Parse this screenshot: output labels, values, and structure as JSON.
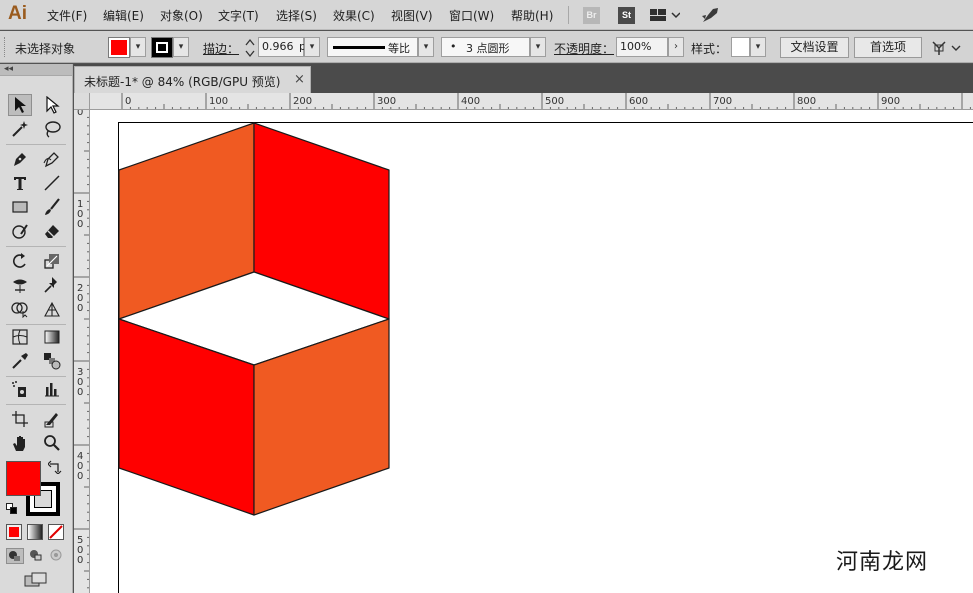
{
  "app": {
    "logo": "Ai"
  },
  "menu": {
    "items": [
      "文件(F)",
      "编辑(E)",
      "对象(O)",
      "文字(T)",
      "选择(S)",
      "效果(C)",
      "视图(V)",
      "窗口(W)",
      "帮助(H)"
    ],
    "bridge_label": "Br",
    "stock_label": "St"
  },
  "control": {
    "selection_status": "未选择对象",
    "stroke_label": "描边：",
    "stroke_weight": "0.966",
    "stroke_unit": "p",
    "profile_label": "等比",
    "brush_label": "3 点圆形",
    "opacity_label": "不透明度：",
    "opacity_value": "100%",
    "style_label": "样式：",
    "doc_setup_button": "文档设置",
    "preferences_button": "首选项",
    "fill_color": "#ff0000",
    "stroke_color": "#000000"
  },
  "tools": {
    "header": "◂◂",
    "fill_color": "#ff0000",
    "stroke_color": "#000000"
  },
  "document": {
    "tab_title": "未标题-1* @ 84% (RGB/GPU 预览)",
    "close_glyph": "×",
    "zoom": "84%",
    "color_mode": "RGB/GPU 预览"
  },
  "rulers": {
    "horizontal_labels": [
      "0",
      "100",
      "200",
      "300",
      "400",
      "500",
      "600",
      "700",
      "800",
      "900"
    ],
    "vertical_labels": [
      "0",
      "100",
      "200",
      "300",
      "400",
      "500"
    ]
  },
  "artwork": {
    "orange": "#f05a22",
    "red": "#ff0000",
    "white": "#ffffff"
  },
  "watermark": {
    "text": "河南龙网"
  }
}
